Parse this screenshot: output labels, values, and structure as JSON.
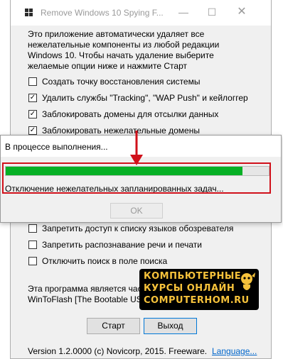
{
  "window": {
    "title": "Remove Windows 10 Spying F...",
    "controls": {
      "minimize": "—",
      "maximize": "☐",
      "close": "✕"
    },
    "intro": [
      "Это приложение автоматически удаляет все",
      "нежелательные компоненты из любой редакции",
      "Windows 10. Чтобы начать удаление выберите",
      "желаемые опции ниже и нажмите Старт"
    ],
    "options": [
      {
        "label": "Создать точку восстановления системы",
        "checked": false
      },
      {
        "label": "Удалить службы \"Tracking\", \"WAP Push\" и кейлоггер",
        "checked": true
      },
      {
        "label": "Заблокировать домены для отсылки данных",
        "checked": true
      },
      {
        "label": "Заблокировать нежелательные домены",
        "checked": true
      },
      {
        "label": "Запретить доступ к списку языков обозревателя",
        "checked": false
      },
      {
        "label": "Запретить распознавание речи и печати",
        "checked": false
      },
      {
        "label": "Отключить поиск в поле поиска",
        "checked": false
      }
    ],
    "footer": [
      "Эта программа является часть",
      "WinToFlash [The Bootable USB Cr"
    ],
    "start_label": "Старт",
    "exit_label": "Выход",
    "version": "Version 1.2.0000  (c) Novicorp, 2015. Freeware.",
    "language_link": "Language..."
  },
  "progress_dialog": {
    "title": "В процессе выполнения...",
    "progress": 0.9,
    "status": "Отключение нежелательных запланированных задач...",
    "ok_label": "OK",
    "highlight_color": "#d0111b",
    "progress_color": "#06b025"
  },
  "watermark": {
    "line1": "КОМПЬЮТЕРНЫЕ",
    "line2": "КУРСЫ  ОНЛАЙН",
    "line3": "COMPUTERHOM.RU"
  }
}
